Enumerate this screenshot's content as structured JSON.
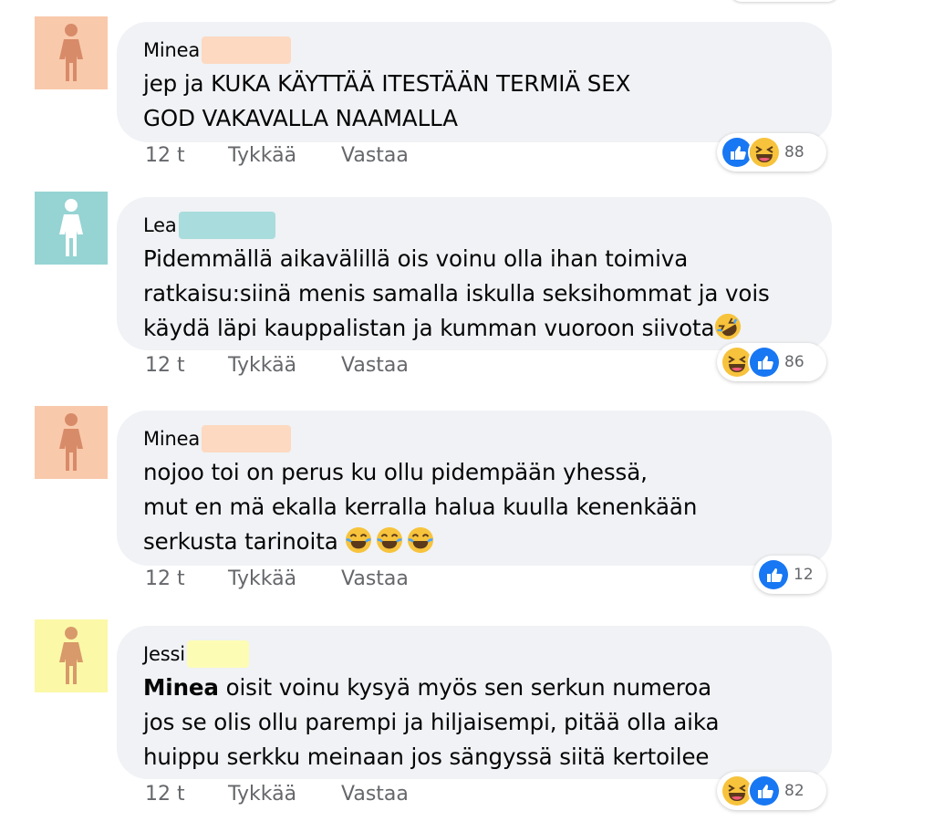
{
  "comments": [
    {
      "name": "Minea",
      "name_mask_color": "#fcd9c0",
      "avatar_bg": "#f9c9ab",
      "avatar_figure": "#d88b69",
      "lines": [
        "jep ja KUKA KÄYTTÄÄ ITESTÄÄN TERMIÄ SEX",
        "GOD VAKAVALLA NAAMALLA"
      ],
      "time": "12 t",
      "like": "Tykkää",
      "reply": "Vastaa",
      "reactions": [
        "like-icon",
        "laugh-icon"
      ],
      "reaction_count": "88"
    },
    {
      "name": "Lea",
      "name_mask_color": "#a9dcdc",
      "avatar_bg": "#96d3d3",
      "avatar_figure": "#ffffff",
      "lines": [
        "Pidemmällä aikavälillä ois voinu olla ihan toimiva",
        "ratkaisu:siinä menis samalla iskulla seksihommat ja vois",
        "käydä läpi kauppalistan ja kumman vuoroon siivota"
      ],
      "time": "12 t",
      "like": "Tykkää",
      "reply": "Vastaa",
      "reactions": [
        "laugh-icon",
        "like-icon"
      ],
      "reaction_count": "86"
    },
    {
      "name": "Minea",
      "name_mask_color": "#fcd9c0",
      "avatar_bg": "#f9c9ab",
      "avatar_figure": "#d88b69",
      "lines": [
        "nojoo toi on perus ku ollu pidempään yhessä,",
        "mut en mä ekalla kerralla halua kuulla kenenkään",
        "serkusta tarinoita"
      ],
      "time": "12 t",
      "like": "Tykkää",
      "reply": "Vastaa",
      "reactions": [
        "like-icon"
      ],
      "reaction_count": "12"
    },
    {
      "name": "Jessi",
      "name_mask_color": "#fdfcb5",
      "avatar_bg": "#fbf8a8",
      "avatar_figure": "#d89a6a",
      "mention": "Minea",
      "lines": [
        " oisit voinu kysyä myös sen serkun numeroa",
        "jos se olis ollu parempi ja hiljaisempi, pitää olla aika",
        "huippu serkku meinaan jos sängyssä siitä kertoilee"
      ],
      "time": "12 t",
      "like": "Tykkää",
      "reply": "Vastaa",
      "reactions": [
        "laugh-icon",
        "like-icon"
      ],
      "reaction_count": "82"
    }
  ],
  "colors": {
    "bubble": "#f0f2f5",
    "like_blue": "#1877f2",
    "meta_gray": "#65676b"
  }
}
